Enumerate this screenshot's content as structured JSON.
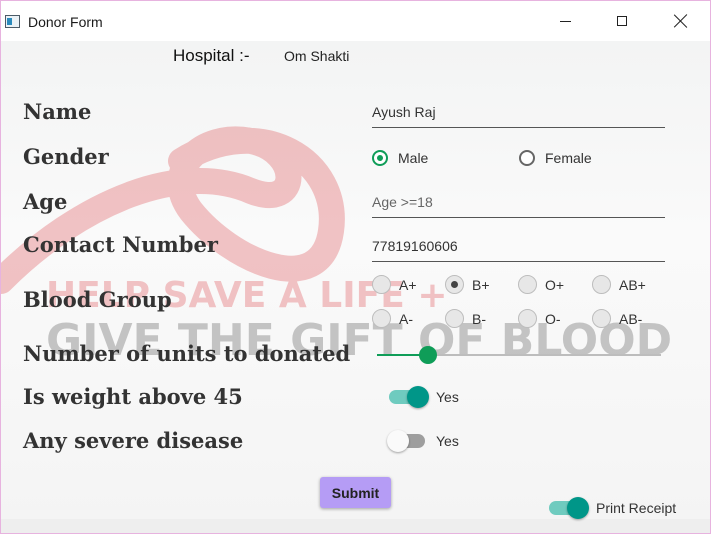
{
  "window": {
    "title": "Donor Form"
  },
  "hospital": {
    "label": "Hospital :-",
    "value": "Om Shakti"
  },
  "background": {
    "line1": "HELP SAVE A LIFE +",
    "line2": "GIVE THE GIFT OF BLOOD"
  },
  "fields": {
    "name": {
      "label": "Name",
      "value": "Ayush Raj"
    },
    "gender": {
      "label": "Gender",
      "options": [
        "Male",
        "Female"
      ],
      "selected": "Male"
    },
    "age": {
      "label": "Age",
      "placeholder": "Age >=18"
    },
    "contact": {
      "label": "Contact Number",
      "value": "77819160606"
    },
    "blood_group": {
      "label": "Blood Group",
      "options": [
        "A+",
        "B+",
        "O+",
        "AB+",
        "A-",
        "B-",
        "O-",
        "AB-"
      ],
      "selected": "B+"
    },
    "units": {
      "label": "Number of units to donated",
      "slider_fraction": 0.18
    },
    "weight": {
      "label": "Is weight above 45",
      "toggle_label": "Yes",
      "on": true
    },
    "disease": {
      "label": "Any severe disease",
      "toggle_label": "Yes",
      "on": false
    }
  },
  "submit_label": "Submit",
  "print_receipt": {
    "label": "Print Receipt",
    "on": true
  },
  "colors": {
    "accent_green": "#0f9d58",
    "toggle_teal": "#009688",
    "submit_bg": "#b59cf5"
  }
}
